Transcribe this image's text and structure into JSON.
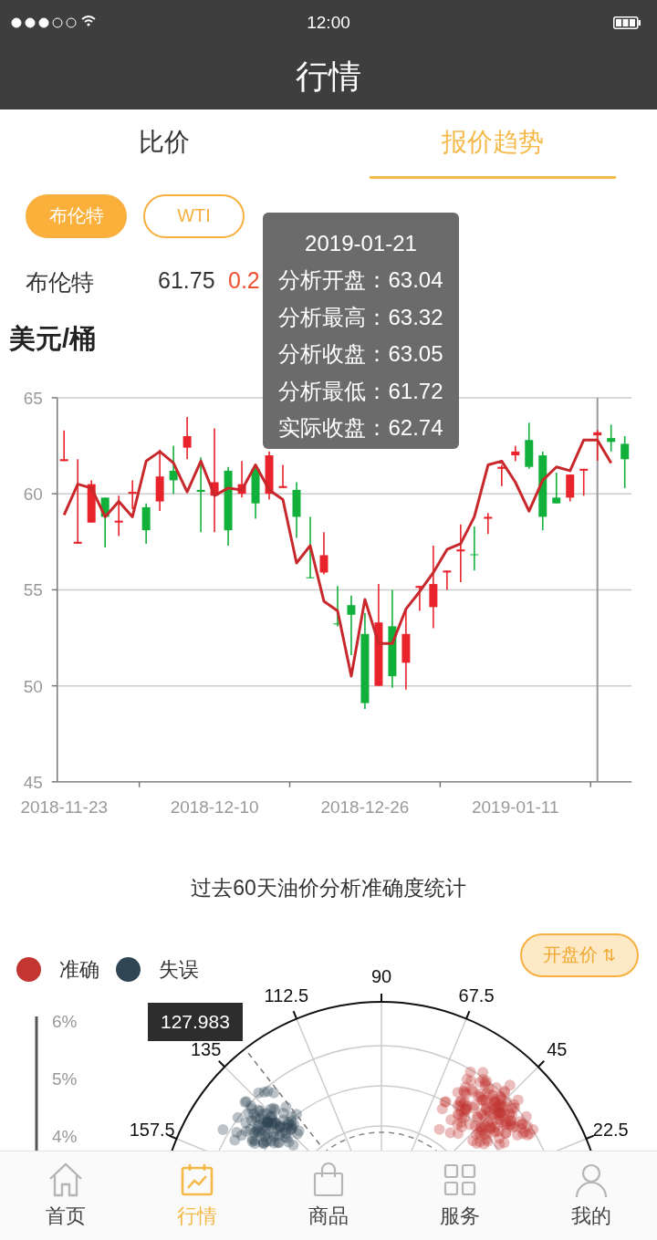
{
  "status_bar": {
    "time": "12:00"
  },
  "nav_bar": {
    "title": "行情"
  },
  "tabs": [
    {
      "label": "比价",
      "selected": false
    },
    {
      "label": "报价趋势",
      "selected": true
    }
  ],
  "filters": [
    {
      "label": "布伦特",
      "selected": true
    },
    {
      "label": "WTI",
      "selected": false
    }
  ],
  "quote": {
    "name": "布伦特",
    "price": "61.75",
    "change": "0.2"
  },
  "price_chart": {
    "unit": "美元/桶",
    "tooltip": {
      "date": "2019-01-21",
      "crosshair": true,
      "rows": [
        "分析开盘：63.04",
        "分析最高：63.32",
        "分析收盘：63.05",
        "分析最低：61.72",
        "实际收盘：62.74"
      ]
    },
    "chart_data": {
      "type": "candlestick",
      "grid": true,
      "ylim": [
        45,
        65
      ],
      "yticks": [
        45,
        50,
        55,
        60,
        65
      ],
      "categories": [
        "2018-11-23",
        null,
        null,
        null,
        null,
        null,
        null,
        null,
        null,
        null,
        null,
        "2018-12-10",
        null,
        null,
        null,
        null,
        null,
        null,
        null,
        null,
        null,
        null,
        "2018-12-26",
        null,
        null,
        null,
        null,
        null,
        null,
        null,
        null,
        null,
        null,
        "2019-01-11",
        null,
        null,
        null,
        null,
        null,
        null,
        null,
        null
      ],
      "series": [
        {
          "type": "line",
          "color": "#c8282b",
          "values": [
            58.9,
            60.5,
            60.3,
            58.8,
            59.6,
            58.8,
            61.7,
            62.2,
            61.6,
            60.1,
            61.7,
            59.9,
            60.3,
            60.2,
            61.5,
            60.2,
            59.7,
            56.4,
            57.3,
            54.4,
            53.9,
            50.5,
            54.5,
            52.2,
            52.2,
            54.0,
            54.9,
            55.9,
            57.1,
            57.4,
            58.8,
            61.5,
            61.7,
            60.6,
            59.1,
            60.7,
            61.4,
            61.2,
            62.8,
            62.8,
            61.6,
            null
          ]
        }
      ],
      "ohlc": [
        [
          61.7,
          63.3,
          61.7,
          61.8
        ],
        [
          57.4,
          61.8,
          57.4,
          57.5
        ],
        [
          58.5,
          60.7,
          58.5,
          60.5
        ],
        [
          59.8,
          59.8,
          57.2,
          58.8
        ],
        [
          58.5,
          59.9,
          57.8,
          58.6
        ],
        [
          60.0,
          60.7,
          59.2,
          60.1
        ],
        [
          59.3,
          59.5,
          57.4,
          58.1
        ],
        [
          59.6,
          62.3,
          59.1,
          60.9
        ],
        [
          61.2,
          62.5,
          60.0,
          60.7
        ],
        [
          62.4,
          64.0,
          61.8,
          63.0
        ],
        [
          60.2,
          61.9,
          58.0,
          60.1
        ],
        [
          59.9,
          63.4,
          58.0,
          60.6
        ],
        [
          61.2,
          61.4,
          57.3,
          58.1
        ],
        [
          60.0,
          61.7,
          59.8,
          60.5
        ],
        [
          61.3,
          61.4,
          58.7,
          59.5
        ],
        [
          60.0,
          62.2,
          59.7,
          62.0
        ],
        [
          60.3,
          61.5,
          60.3,
          60.4
        ],
        [
          60.2,
          60.6,
          57.7,
          58.8
        ],
        [
          55.65,
          58.8,
          55.6,
          55.6
        ],
        [
          55.9,
          58.0,
          55.8,
          56.8
        ],
        [
          53.25,
          55.2,
          53.1,
          53.2
        ],
        [
          54.2,
          54.7,
          51.6,
          53.7
        ],
        [
          52.7,
          53.8,
          48.8,
          49.1
        ],
        [
          50.0,
          55.3,
          50.0,
          53.3
        ],
        [
          53.1,
          55.0,
          49.9,
          50.5
        ],
        [
          51.2,
          54.0,
          49.8,
          52.7
        ],
        [
          55.1,
          55.2,
          53.9,
          55.2
        ],
        [
          54.1,
          57.3,
          53.0,
          55.3
        ],
        [
          55.9,
          56.0,
          55.0,
          56.0
        ],
        [
          57.0,
          58.4,
          55.4,
          57.1
        ],
        [
          56.85,
          58.3,
          56.0,
          56.8
        ],
        [
          58.7,
          59.0,
          57.9,
          58.8
        ],
        [
          61.3,
          61.5,
          60.4,
          61.4
        ],
        [
          62.0,
          62.5,
          61.7,
          62.2
        ],
        [
          62.8,
          63.7,
          61.3,
          61.4
        ],
        [
          62.0,
          62.2,
          58.1,
          58.8
        ],
        [
          59.8,
          61.1,
          59.5,
          59.5
        ],
        [
          59.8,
          61.0,
          59.6,
          61.0
        ],
        [
          61.2,
          61.3,
          59.9,
          61.3
        ],
        [
          63.04,
          63.32,
          61.72,
          63.2
        ],
        [
          62.9,
          63.6,
          62.2,
          62.7
        ],
        [
          62.6,
          63.0,
          60.3,
          61.8
        ]
      ]
    }
  },
  "accuracy": {
    "title": "过去60天油价分析准确度统计",
    "toggle": {
      "label": "开盘价",
      "icon": "⇅"
    },
    "legend": [
      {
        "label": "准确",
        "color": "#c23531"
      },
      {
        "label": "失误",
        "color": "#2f4554"
      }
    ],
    "angle_labels": [
      "22.5",
      "45",
      "67.5",
      "90",
      "112.5",
      "135",
      "157.5"
    ],
    "radius_labels": [
      "6%",
      "5%",
      "4%"
    ],
    "tooltip": "127.983"
  },
  "bottom_nav": [
    {
      "label": "首页",
      "kind": "home",
      "selected": false
    },
    {
      "label": "行情",
      "kind": "chart",
      "selected": true
    },
    {
      "label": "商品",
      "kind": "bag",
      "selected": false
    },
    {
      "label": "服务",
      "kind": "grid",
      "selected": false
    },
    {
      "label": "我的",
      "kind": "user",
      "selected": false
    }
  ]
}
